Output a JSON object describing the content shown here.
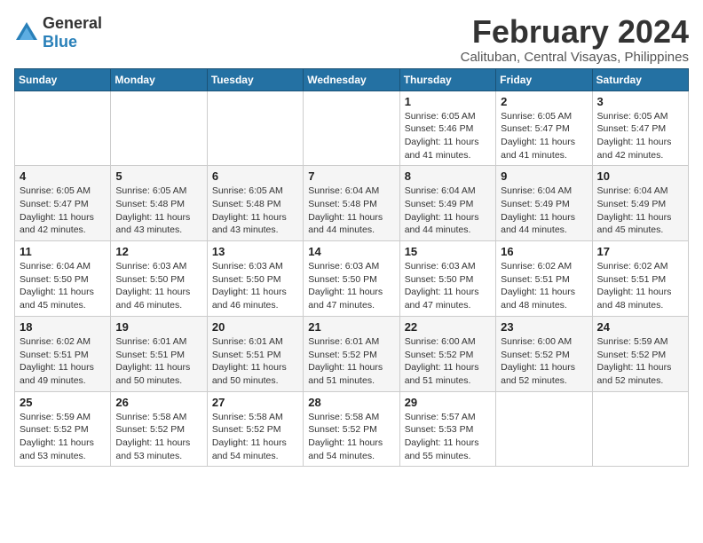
{
  "logo": {
    "general": "General",
    "blue": "Blue"
  },
  "title": "February 2024",
  "location": "Calituban, Central Visayas, Philippines",
  "days_of_week": [
    "Sunday",
    "Monday",
    "Tuesday",
    "Wednesday",
    "Thursday",
    "Friday",
    "Saturday"
  ],
  "weeks": [
    [
      {
        "day": "",
        "info": ""
      },
      {
        "day": "",
        "info": ""
      },
      {
        "day": "",
        "info": ""
      },
      {
        "day": "",
        "info": ""
      },
      {
        "day": "1",
        "info": "Sunrise: 6:05 AM\nSunset: 5:46 PM\nDaylight: 11 hours and 41 minutes."
      },
      {
        "day": "2",
        "info": "Sunrise: 6:05 AM\nSunset: 5:47 PM\nDaylight: 11 hours and 41 minutes."
      },
      {
        "day": "3",
        "info": "Sunrise: 6:05 AM\nSunset: 5:47 PM\nDaylight: 11 hours and 42 minutes."
      }
    ],
    [
      {
        "day": "4",
        "info": "Sunrise: 6:05 AM\nSunset: 5:47 PM\nDaylight: 11 hours and 42 minutes."
      },
      {
        "day": "5",
        "info": "Sunrise: 6:05 AM\nSunset: 5:48 PM\nDaylight: 11 hours and 43 minutes."
      },
      {
        "day": "6",
        "info": "Sunrise: 6:05 AM\nSunset: 5:48 PM\nDaylight: 11 hours and 43 minutes."
      },
      {
        "day": "7",
        "info": "Sunrise: 6:04 AM\nSunset: 5:48 PM\nDaylight: 11 hours and 44 minutes."
      },
      {
        "day": "8",
        "info": "Sunrise: 6:04 AM\nSunset: 5:49 PM\nDaylight: 11 hours and 44 minutes."
      },
      {
        "day": "9",
        "info": "Sunrise: 6:04 AM\nSunset: 5:49 PM\nDaylight: 11 hours and 44 minutes."
      },
      {
        "day": "10",
        "info": "Sunrise: 6:04 AM\nSunset: 5:49 PM\nDaylight: 11 hours and 45 minutes."
      }
    ],
    [
      {
        "day": "11",
        "info": "Sunrise: 6:04 AM\nSunset: 5:50 PM\nDaylight: 11 hours and 45 minutes."
      },
      {
        "day": "12",
        "info": "Sunrise: 6:03 AM\nSunset: 5:50 PM\nDaylight: 11 hours and 46 minutes."
      },
      {
        "day": "13",
        "info": "Sunrise: 6:03 AM\nSunset: 5:50 PM\nDaylight: 11 hours and 46 minutes."
      },
      {
        "day": "14",
        "info": "Sunrise: 6:03 AM\nSunset: 5:50 PM\nDaylight: 11 hours and 47 minutes."
      },
      {
        "day": "15",
        "info": "Sunrise: 6:03 AM\nSunset: 5:50 PM\nDaylight: 11 hours and 47 minutes."
      },
      {
        "day": "16",
        "info": "Sunrise: 6:02 AM\nSunset: 5:51 PM\nDaylight: 11 hours and 48 minutes."
      },
      {
        "day": "17",
        "info": "Sunrise: 6:02 AM\nSunset: 5:51 PM\nDaylight: 11 hours and 48 minutes."
      }
    ],
    [
      {
        "day": "18",
        "info": "Sunrise: 6:02 AM\nSunset: 5:51 PM\nDaylight: 11 hours and 49 minutes."
      },
      {
        "day": "19",
        "info": "Sunrise: 6:01 AM\nSunset: 5:51 PM\nDaylight: 11 hours and 50 minutes."
      },
      {
        "day": "20",
        "info": "Sunrise: 6:01 AM\nSunset: 5:51 PM\nDaylight: 11 hours and 50 minutes."
      },
      {
        "day": "21",
        "info": "Sunrise: 6:01 AM\nSunset: 5:52 PM\nDaylight: 11 hours and 51 minutes."
      },
      {
        "day": "22",
        "info": "Sunrise: 6:00 AM\nSunset: 5:52 PM\nDaylight: 11 hours and 51 minutes."
      },
      {
        "day": "23",
        "info": "Sunrise: 6:00 AM\nSunset: 5:52 PM\nDaylight: 11 hours and 52 minutes."
      },
      {
        "day": "24",
        "info": "Sunrise: 5:59 AM\nSunset: 5:52 PM\nDaylight: 11 hours and 52 minutes."
      }
    ],
    [
      {
        "day": "25",
        "info": "Sunrise: 5:59 AM\nSunset: 5:52 PM\nDaylight: 11 hours and 53 minutes."
      },
      {
        "day": "26",
        "info": "Sunrise: 5:58 AM\nSunset: 5:52 PM\nDaylight: 11 hours and 53 minutes."
      },
      {
        "day": "27",
        "info": "Sunrise: 5:58 AM\nSunset: 5:52 PM\nDaylight: 11 hours and 54 minutes."
      },
      {
        "day": "28",
        "info": "Sunrise: 5:58 AM\nSunset: 5:52 PM\nDaylight: 11 hours and 54 minutes."
      },
      {
        "day": "29",
        "info": "Sunrise: 5:57 AM\nSunset: 5:53 PM\nDaylight: 11 hours and 55 minutes."
      },
      {
        "day": "",
        "info": ""
      },
      {
        "day": "",
        "info": ""
      }
    ]
  ]
}
